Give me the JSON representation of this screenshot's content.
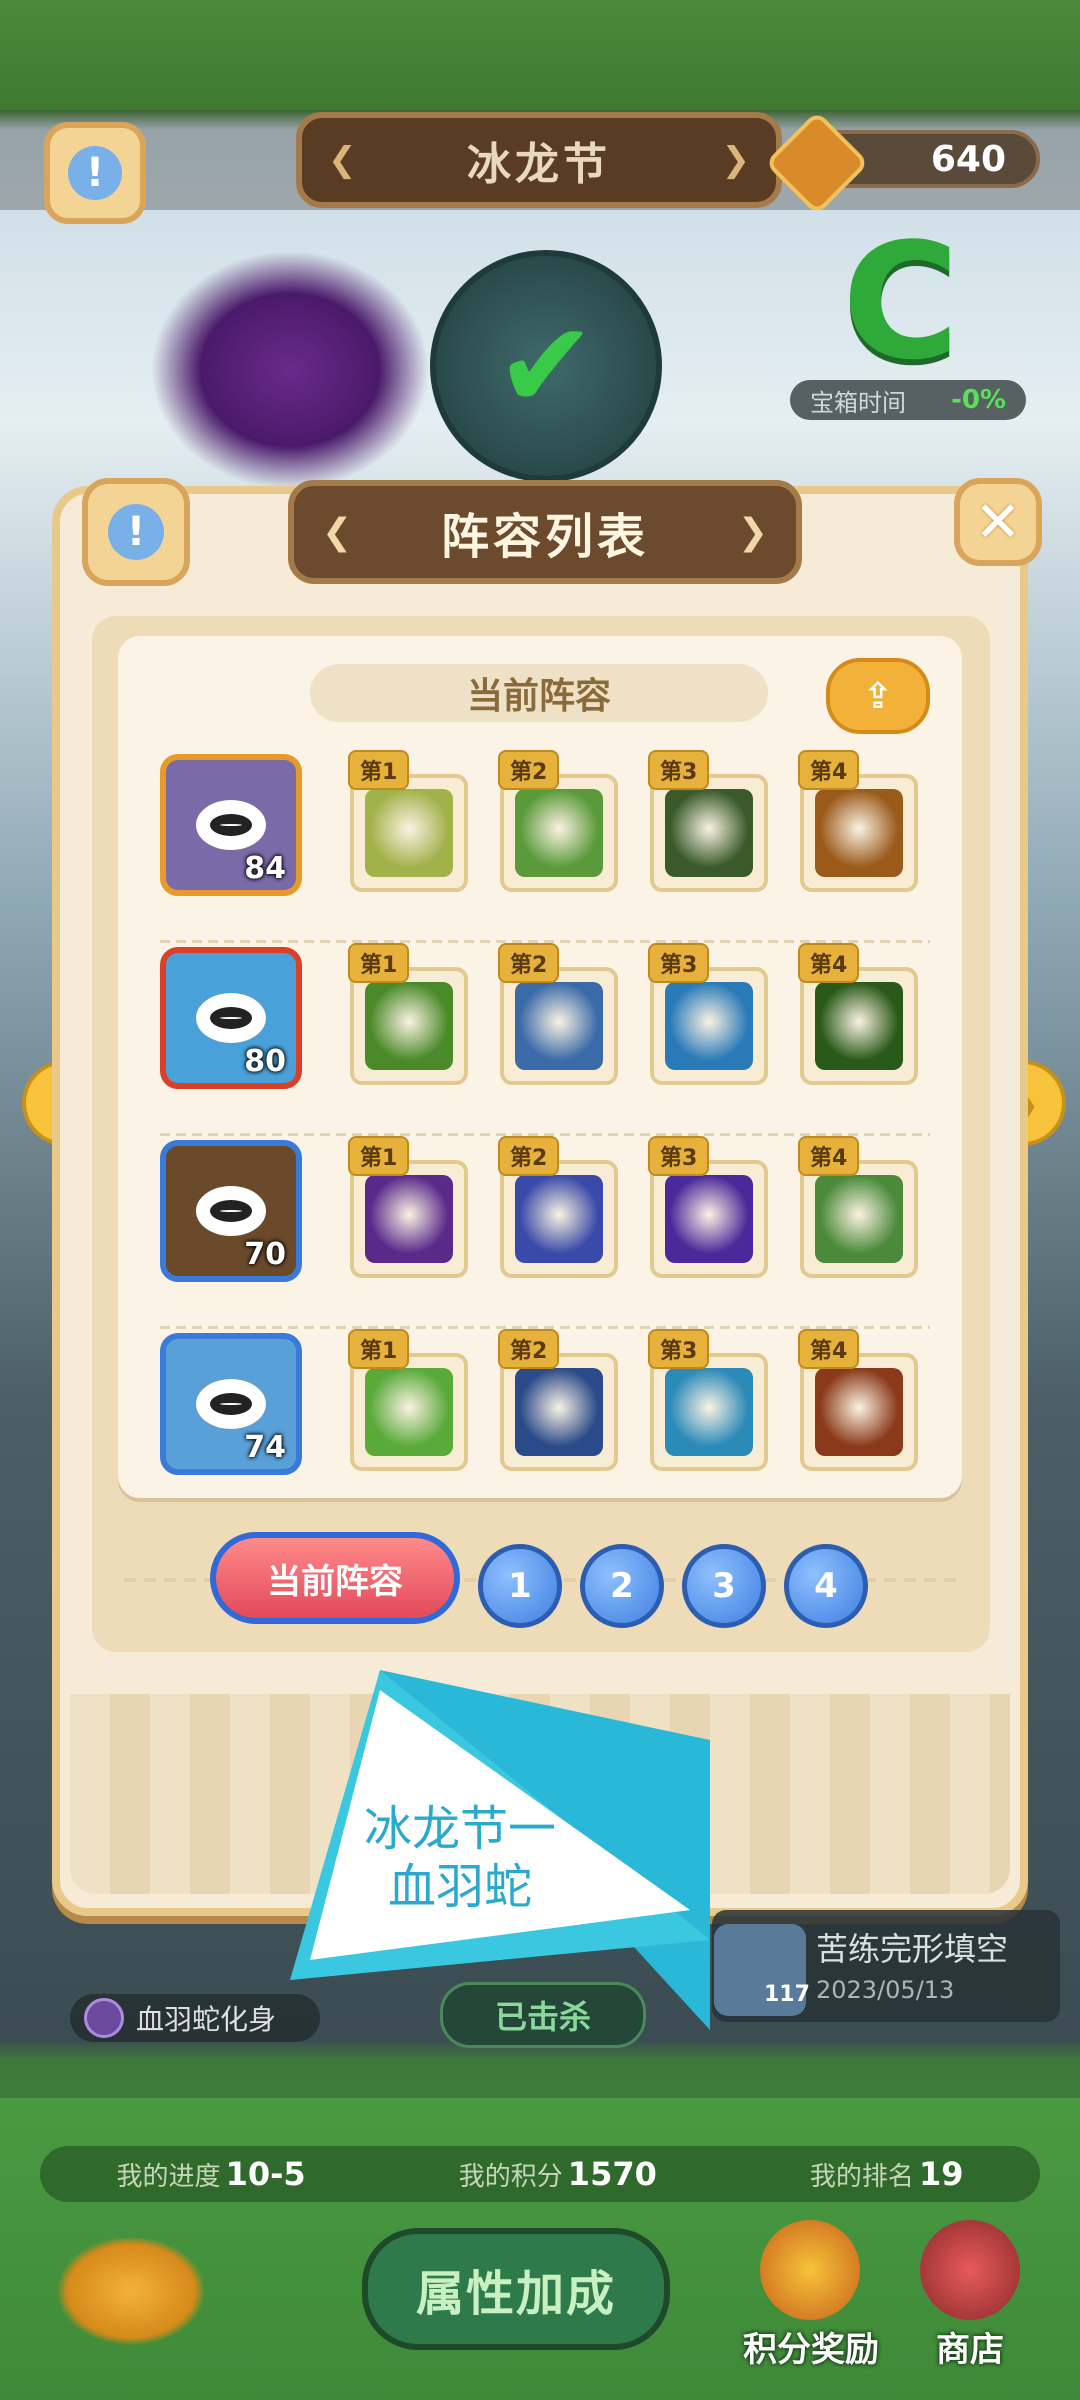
{
  "header": {
    "title": "冰龙节",
    "coins": "640",
    "chest_time_label": "宝箱时间",
    "chest_time_value": "-0%",
    "grade": "C"
  },
  "dialog": {
    "title": "阵容列表",
    "section_title": "当前阵容",
    "lineups": [
      {
        "hero_icon": "duck-knight-hero-icon",
        "level": "84",
        "frame": "#e79a2a",
        "bg": "#7b6aa8",
        "skills": [
          {
            "tag": "第1",
            "icon": "golden-shield-icon",
            "color": "#a2b24a"
          },
          {
            "tag": "第2",
            "icon": "star-shield-icon",
            "color": "#5a9a3a"
          },
          {
            "tag": "第3",
            "icon": "dark-helmet-icon",
            "color": "#3a5a2a"
          },
          {
            "tag": "第4",
            "icon": "crystal-strike-icon",
            "color": "#9a5a1a"
          }
        ]
      },
      {
        "hero_icon": "blue-fish-hero-icon",
        "level": "80",
        "frame": "#d8402a",
        "bg": "#4aa0d8",
        "skills": [
          {
            "tag": "第1",
            "icon": "green-armor-icon",
            "color": "#4a8a2a"
          },
          {
            "tag": "第2",
            "icon": "lion-warrior-icon",
            "color": "#3a6aa8"
          },
          {
            "tag": "第3",
            "icon": "spear-icon",
            "color": "#2a7ab8"
          },
          {
            "tag": "第4",
            "icon": "green-blade-icon",
            "color": "#2a5a1a"
          }
        ]
      },
      {
        "hero_icon": "mole-hero-icon",
        "level": "70",
        "frame": "#3a7ad8",
        "bg": "#6a4a2a",
        "skills": [
          {
            "tag": "第1",
            "icon": "purple-burst-icon",
            "color": "#5a2a8a"
          },
          {
            "tag": "第2",
            "icon": "blue-slash-icon",
            "color": "#3a4aa8"
          },
          {
            "tag": "第3",
            "icon": "arcane-circle-icon",
            "color": "#4a2a9a"
          },
          {
            "tag": "第4",
            "icon": "peach-plant-icon",
            "color": "#4a8a3a"
          }
        ]
      },
      {
        "hero_icon": "armored-pig-hero-icon",
        "level": "74",
        "frame": "#3a7ad8",
        "bg": "#5aa0d8",
        "skills": [
          {
            "tag": "第1",
            "icon": "green-cloud-icon",
            "color": "#5aaa3a"
          },
          {
            "tag": "第2",
            "icon": "red-mask-icon",
            "color": "#2a4a8a"
          },
          {
            "tag": "第3",
            "icon": "water-spear-icon",
            "color": "#2a8ab8"
          },
          {
            "tag": "第4",
            "icon": "flame-hammer-icon",
            "color": "#8a3a1a"
          }
        ]
      }
    ],
    "tabs": {
      "current": "当前阵容",
      "pages": [
        "1",
        "2",
        "3",
        "4"
      ]
    }
  },
  "watermark": {
    "line1": "冰龙节一",
    "line2": "血羽蛇"
  },
  "under_dialog": {
    "boss_name": "血羽蛇化身",
    "killed_label": "已击杀",
    "record_title": "苦练完形填空",
    "record_level": "117",
    "record_date": "2023/05/13"
  },
  "footer": {
    "progress_label": "我的进度",
    "progress_value": "10-5",
    "score_label": "我的积分",
    "score_value": "1570",
    "rank_label": "我的排名",
    "rank_value": "19",
    "attr_button": "属性加成",
    "reward_label": "积分奖励",
    "shop_label": "商店"
  }
}
